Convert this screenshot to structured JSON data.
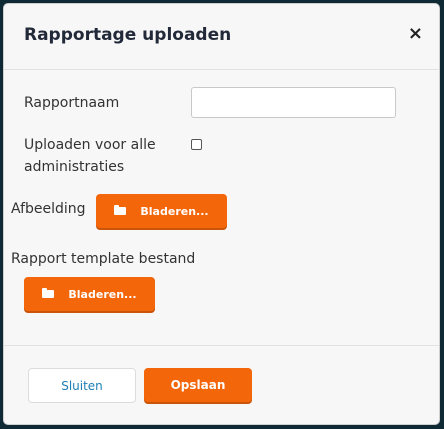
{
  "dialog": {
    "title": "Rapportage uploaden",
    "close_glyph": "×"
  },
  "form": {
    "name_label": "Rapportnaam",
    "name_value": "",
    "all_admins_label_line1": "Uploaden voor alle",
    "all_admins_label_line2": "administraties",
    "all_admins_checked": false,
    "image_label": "Afbeelding",
    "image_browse_label": "Bladeren...",
    "template_label": "Rapport template bestand",
    "template_browse_label": "Bladeren..."
  },
  "footer": {
    "close_label": "Sluiten",
    "save_label": "Opslaan"
  },
  "colors": {
    "accent": "#f4660a",
    "link": "#1d7fb3"
  }
}
